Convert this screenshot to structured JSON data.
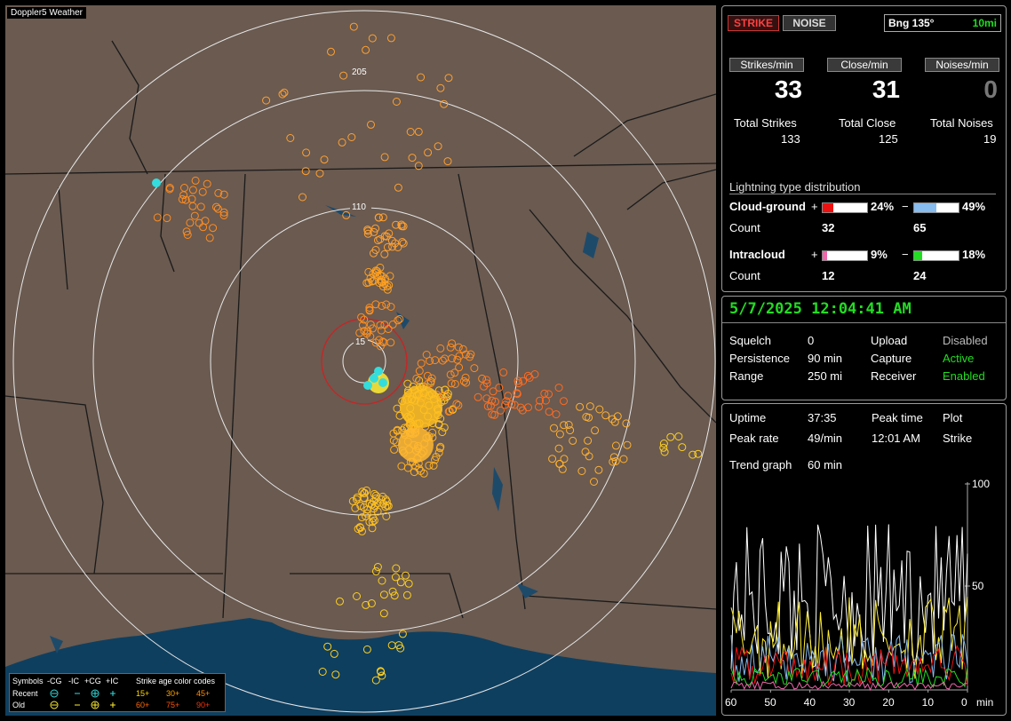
{
  "app": {
    "title": "Doppler5 Weather"
  },
  "map": {
    "ring_labels": [
      "205",
      "110",
      "15"
    ]
  },
  "legend": {
    "symbols_label": "Symbols",
    "col_headers": [
      "-CG",
      "-IC",
      "+CG",
      "+IC"
    ],
    "recent_label": "Recent",
    "old_label": "Old",
    "age_title": "Strike age color codes",
    "age_codes": [
      "15+",
      "30+",
      "45+",
      "60+",
      "75+",
      "90+"
    ],
    "age_colors": [
      "#ffd700",
      "#ffa500",
      "#ff8c00",
      "#ff6a00",
      "#ff5500",
      "#ff3300"
    ]
  },
  "toolbar": {
    "strike_label": "STRIKE",
    "noise_label": "NOISE",
    "bearing_label": "Bng 135°",
    "range_label": "10mi"
  },
  "stats": {
    "strikes_per_min_label": "Strikes/min",
    "close_per_min_label": "Close/min",
    "noises_per_min_label": "Noises/min",
    "strikes_per_min": "33",
    "close_per_min": "31",
    "noises_per_min": "0",
    "total_strikes_label": "Total Strikes",
    "total_close_label": "Total Close",
    "total_noises_label": "Total Noises",
    "total_strikes": "133",
    "total_close": "125",
    "total_noises": "19"
  },
  "distribution": {
    "title": "Lightning type distribution",
    "cg_label": "Cloud-ground",
    "ic_label": "Intracloud",
    "count_label": "Count",
    "plus": "+",
    "minus": "−",
    "cg_pos_pct": "24%",
    "cg_neg_pct": "49%",
    "ic_pos_pct": "9%",
    "ic_neg_pct": "18%",
    "cg_pos_count": "32",
    "cg_neg_count": "65",
    "ic_pos_count": "12",
    "ic_neg_count": "24",
    "cg_pos_frac": 0.24,
    "cg_neg_frac": 0.49,
    "ic_pos_frac": 0.09,
    "ic_neg_frac": 0.18,
    "colors": {
      "cg_pos": "#ee1111",
      "cg_neg": "#88bbee",
      "ic_pos": "#ee66aa",
      "ic_neg": "#22dd22"
    }
  },
  "status": {
    "datetime": "5/7/2025 12:04:41 AM",
    "squelch_label": "Squelch",
    "squelch": "0",
    "persistence_label": "Persistence",
    "persistence": "90 min",
    "range_label": "Range",
    "range": "250 mi",
    "upload_label": "Upload",
    "upload": "Disabled",
    "capture_label": "Capture",
    "capture": "Active",
    "receiver_label": "Receiver",
    "receiver": "Enabled"
  },
  "trend": {
    "uptime_label": "Uptime",
    "uptime": "37:35",
    "peak_time_label": "Peak time",
    "peak_time": "12:01 AM",
    "plot_label": "Plot",
    "plot": "Strike",
    "peak_rate_label": "Peak rate",
    "peak_rate": "49/min",
    "trend_graph_label": "Trend graph",
    "trend_graph": "60 min",
    "y_ticks": [
      "100",
      "50"
    ],
    "x_ticks": [
      "60",
      "50",
      "40",
      "30",
      "20",
      "10",
      "0"
    ],
    "x_unit": "min"
  }
}
